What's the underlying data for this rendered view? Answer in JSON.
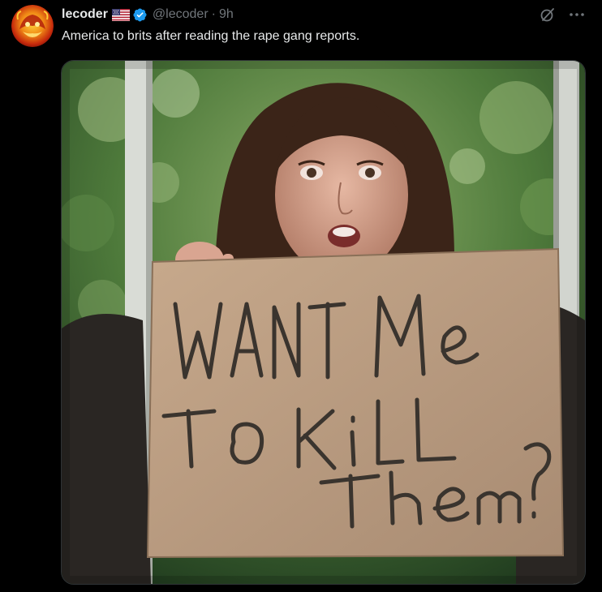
{
  "post": {
    "display_name": "lecoder",
    "handle": "@lecoder",
    "separator": "·",
    "time": "9h",
    "text": "America to brits after reading the rape gang reports.",
    "flag_icon": "us-flag-icon",
    "verified_icon": "verified-badge-icon",
    "grok_icon": "grok-icon",
    "more_icon": "more-options-icon"
  },
  "media": {
    "sign_lines": [
      "WANT Me",
      "To KiLL",
      "Them?"
    ]
  },
  "colors": {
    "background": "#000000",
    "text_primary": "#e7e9ea",
    "text_secondary": "#71767b",
    "verified_blue": "#1d9bf0",
    "media_border": "#2f3336"
  }
}
